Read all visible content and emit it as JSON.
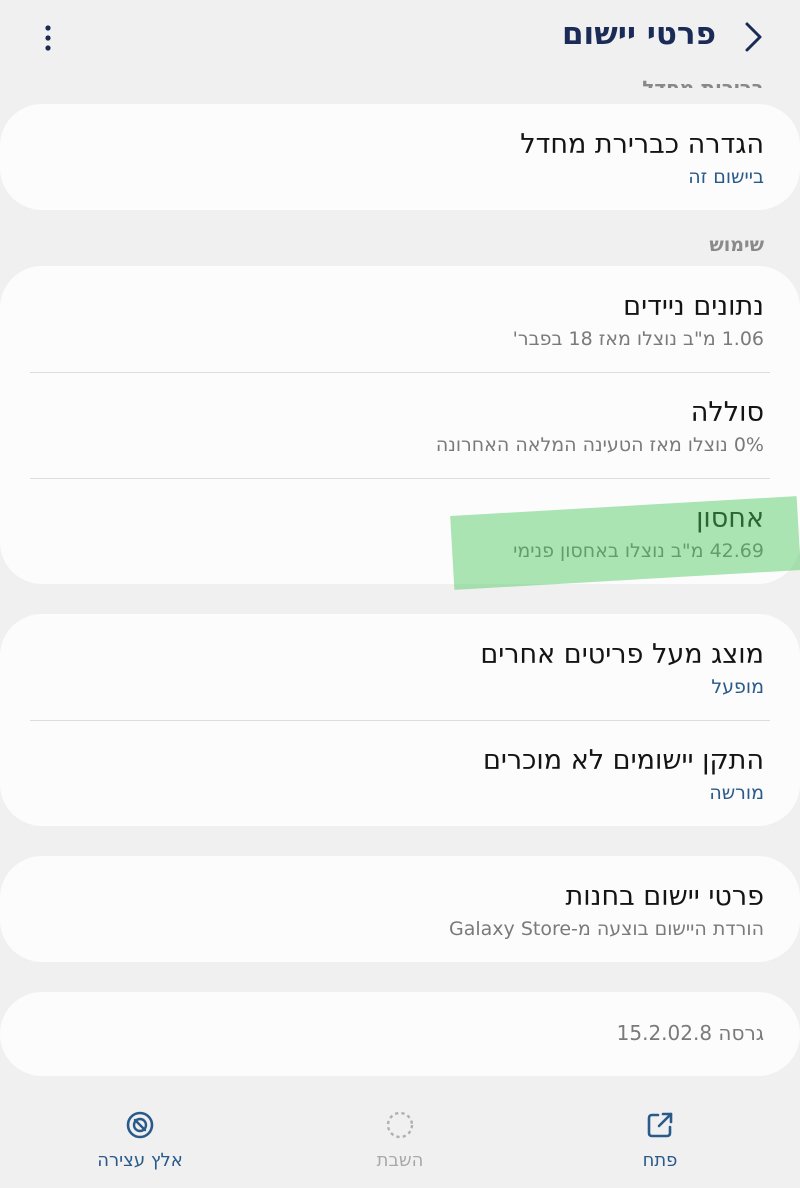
{
  "header": {
    "title": "פרטי יישום"
  },
  "sections": {
    "defaults_header": "ברירות מחדל",
    "usage_header": "שימוש"
  },
  "defaults": {
    "set_default_title": "הגדרה כברירת מחדל",
    "set_default_sub": "ביישום זה"
  },
  "usage": {
    "mobile_data_title": "נתונים ניידים",
    "mobile_data_sub": "1.06 מ\"ב נוצלו מאז 18 בפבר'",
    "battery_title": "סוללה",
    "battery_sub": "0% נוצלו מאז הטעינה המלאה האחרונה",
    "storage_title": "אחסון",
    "storage_sub": "42.69 מ\"ב נוצלו באחסון פנימי"
  },
  "permissions": {
    "overlay_title": "מוצג מעל פריטים אחרים",
    "overlay_sub": "מופעל",
    "install_unknown_title": "התקן יישומים לא מוכרים",
    "install_unknown_sub": "מורשה"
  },
  "store": {
    "title": "פרטי יישום בחנות",
    "sub": "הורדת היישום בוצעה מ-Galaxy Store"
  },
  "version": {
    "text": "גרסה 15.2.02.8"
  },
  "bottom_bar": {
    "open_label": "פתח",
    "disable_label": "השבת",
    "force_stop_label": "אלץ עצירה"
  },
  "colors": {
    "accent": "#2a5a8a",
    "title": "#1a2b57",
    "highlight": "#48c85a"
  }
}
